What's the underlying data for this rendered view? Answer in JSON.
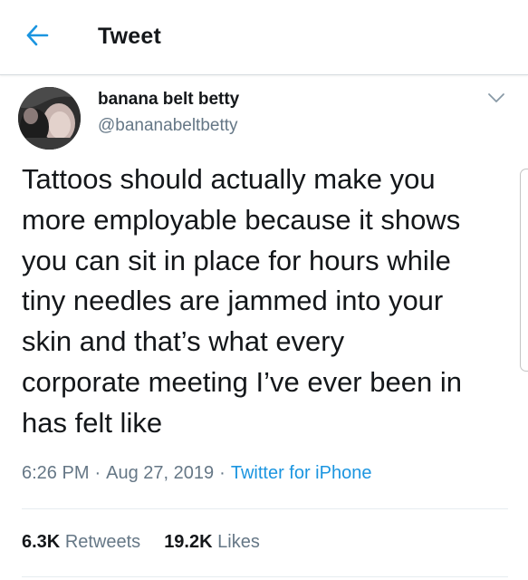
{
  "header": {
    "title": "Tweet",
    "back_icon": "arrow-left-icon",
    "accent_color": "#1b95e0"
  },
  "author": {
    "display_name": "banana belt betty",
    "handle": "@bananabeltbetty",
    "menu_icon": "chevron-down-icon"
  },
  "tweet": {
    "text": "Tattoos should actually make you\nmore employable because it shows\nyou can sit in place for hours while\ntiny needles are jammed into your\nskin and that’s what every\ncorporate meeting I’ve ever been in\nhas felt like"
  },
  "meta": {
    "time": "6:26 PM",
    "separator": "·",
    "date": "Aug 27, 2019",
    "source": "Twitter for iPhone"
  },
  "stats": {
    "retweets_count": "6.3K",
    "retweets_label": "Retweets",
    "likes_count": "19.2K",
    "likes_label": "Likes"
  },
  "colors": {
    "text_primary": "#14171a",
    "text_secondary": "#657786",
    "link": "#1b95e0",
    "divider": "#e6ecf0"
  }
}
